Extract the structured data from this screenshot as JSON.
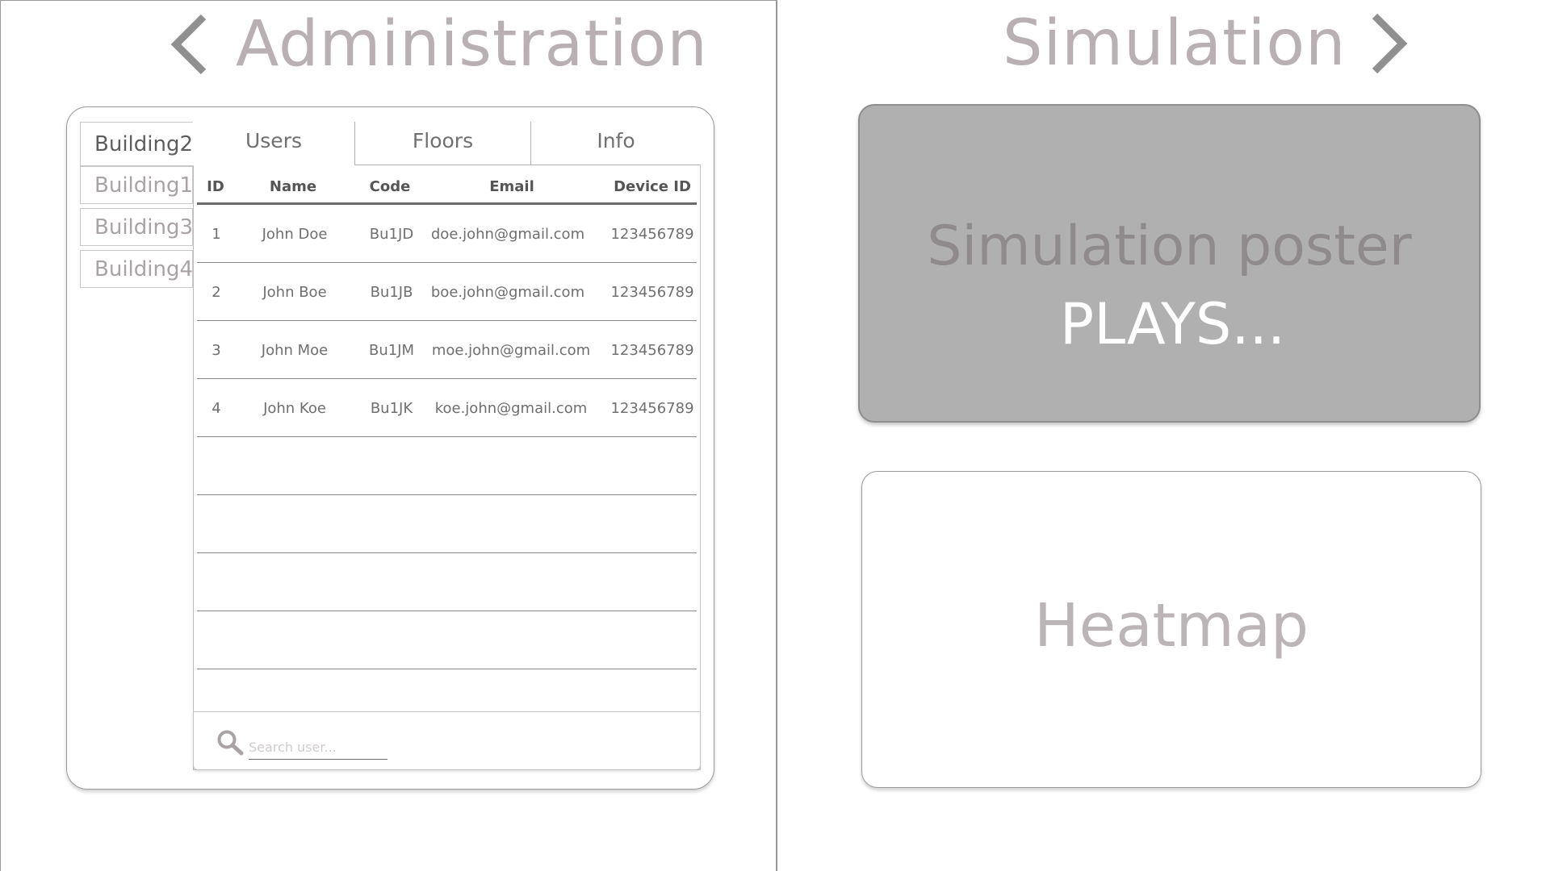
{
  "administration": {
    "title": "Administration",
    "buildings": {
      "active": "Building2",
      "others": [
        "Building1",
        "Building3",
        "Building4"
      ]
    },
    "tabs": [
      "Users",
      "Floors",
      "Info"
    ],
    "table": {
      "headers": [
        "ID",
        "Name",
        "Code",
        "Email",
        "Device ID"
      ],
      "rows": [
        [
          "1",
          "John Doe",
          "Bu1JD",
          "doe.john@gmail.com",
          "123456789"
        ],
        [
          "2",
          "John Boe",
          "Bu1JB",
          "boe.john@gmail.com",
          "123456789"
        ],
        [
          "3",
          "John Moe",
          "Bu1JM",
          "moe.john@gmail.com",
          "123456789"
        ],
        [
          "4",
          "John Koe",
          "Bu1JK",
          "koe.john@gmail.com",
          "123456789"
        ]
      ]
    },
    "search": {
      "placeholder": "Search user..."
    }
  },
  "simulation": {
    "title": "Simulation",
    "poster": {
      "title": "Simulation poster",
      "subtitle": "PLAYS..."
    },
    "heatmap": {
      "label": "Heatmap"
    }
  },
  "icons": {
    "back": "chevron-left-icon",
    "forward": "chevron-right-icon",
    "search": "search-icon"
  },
  "colors": {
    "title_text": "#b8b0b3",
    "chevron": "#8f8f8f",
    "poster_bg": "#b0b0b0"
  }
}
